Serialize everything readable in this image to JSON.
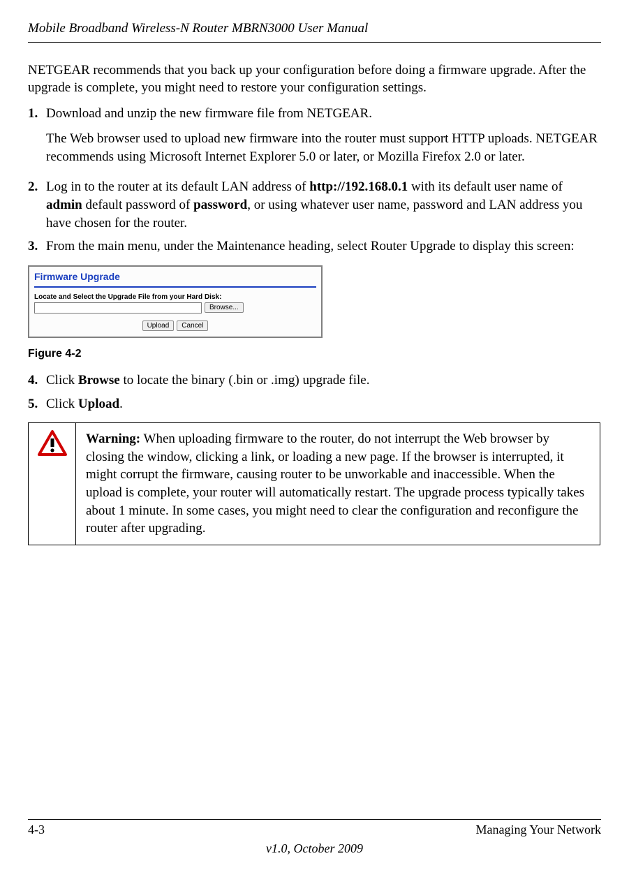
{
  "header": {
    "title": "Mobile Broadband Wireless-N Router MBRN3000 User Manual"
  },
  "intro": "NETGEAR recommends that you back up your configuration before doing a firmware upgrade. After the upgrade is complete, you might need to restore your configuration settings.",
  "steps": {
    "s1": {
      "num": "1.",
      "text": "Download and unzip the new firmware file from NETGEAR.",
      "sub": "The Web browser used to upload new firmware into the router must support HTTP uploads. NETGEAR recommends using Microsoft Internet Explorer 5.0 or later, or Mozilla Firefox 2.0 or later."
    },
    "s2": {
      "num": "2.",
      "pre": "Log in to the router at its default LAN address of ",
      "b1": "http://192.168.0.1",
      "mid1": " with its default user name of ",
      "b2": "admin",
      "mid2": " default password of ",
      "b3": "password",
      "post": ", or using whatever user name, password and LAN address you have chosen for the router."
    },
    "s3": {
      "num": "3.",
      "text": "From the main menu, under the Maintenance heading, select Router Upgrade to display this screen:"
    },
    "s4": {
      "num": "4.",
      "pre": "Click ",
      "b1": "Browse",
      "post": " to locate the binary (.bin or .img) upgrade file."
    },
    "s5": {
      "num": "5.",
      "pre": "Click ",
      "b1": "Upload",
      "post": "."
    }
  },
  "figure": {
    "title": "Firmware Upgrade",
    "label": "Locate and Select the Upgrade File from your Hard Disk:",
    "browse": "Browse...",
    "upload": "Upload",
    "cancel": "Cancel",
    "caption": "Figure 4-2"
  },
  "warning": {
    "label": "Warning:",
    "text": " When uploading firmware to the router, do not interrupt the Web browser by closing the window, clicking a link, or loading a new page. If the browser is interrupted, it might corrupt the firmware, causing router to be unworkable and inaccessible. When the upload is complete, your router will automatically restart. The upgrade process typically takes about 1 minute. In some cases, you might need to clear the configuration and reconfigure the router after upgrading."
  },
  "footer": {
    "page": "4-3",
    "section": "Managing Your Network",
    "version": "v1.0, October 2009"
  }
}
